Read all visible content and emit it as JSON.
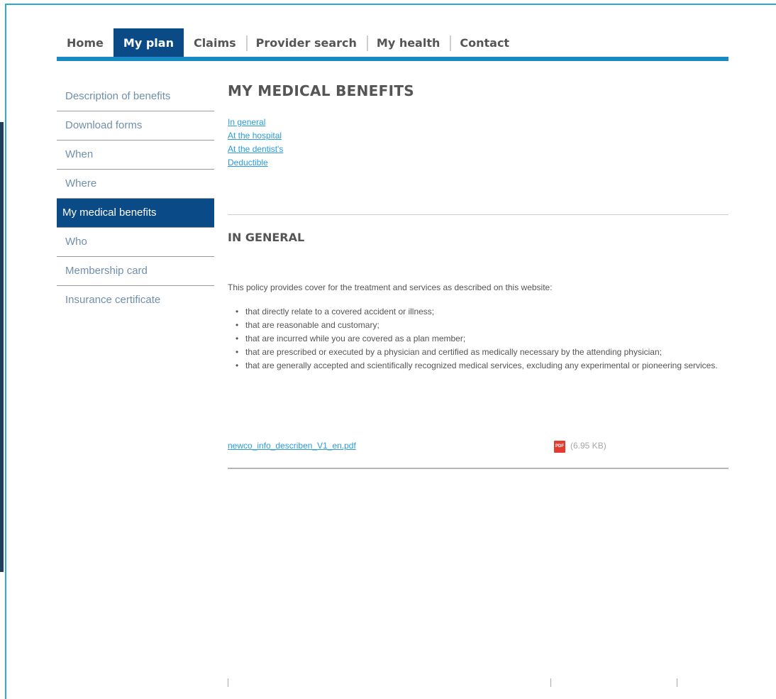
{
  "topnav": {
    "tabs": [
      {
        "label": "Home",
        "active": false
      },
      {
        "label": "My plan",
        "active": true
      },
      {
        "label": "Claims",
        "active": false
      },
      {
        "label": "Provider search",
        "active": false
      },
      {
        "label": "My health",
        "active": false
      },
      {
        "label": "Contact",
        "active": false
      }
    ]
  },
  "sidebar": {
    "items": [
      {
        "label": "Description of benefits"
      },
      {
        "label": "Download forms"
      },
      {
        "label": "When"
      },
      {
        "label": "Where"
      },
      {
        "label": "My medical benefits",
        "active": true
      },
      {
        "label": "Who"
      },
      {
        "label": "Membership card"
      },
      {
        "label": "Insurance certificate"
      }
    ]
  },
  "main": {
    "title": "MY MEDICAL BENEFITS",
    "anchors": [
      "In general",
      "At the hospital",
      "At the dentist's",
      "Deductible"
    ],
    "section_title": "IN GENERAL",
    "intro": "This policy provides cover for the treatment and services as described on this website:",
    "bullets": [
      "that directly relate to a covered accident or illness;",
      "that are reasonable and customary;",
      "that are incurred while you are covered as a plan member;",
      "that are prescribed or executed by a physician and certified as medically necessary by the attending physician;",
      "that are generally accepted and scientifically recognized medical services, excluding any experimental or pioneering services."
    ],
    "download": {
      "filename": "newco_info_describen_V1_en.pdf",
      "icon": "pdf-icon",
      "icon_text": "PDF",
      "size": "(6.95 KB)"
    }
  },
  "colors": {
    "accent": "#0a4a87",
    "link": "#2b9cd8",
    "nav_underline": "#1a8ac7",
    "frame": "#2ea7d8"
  }
}
